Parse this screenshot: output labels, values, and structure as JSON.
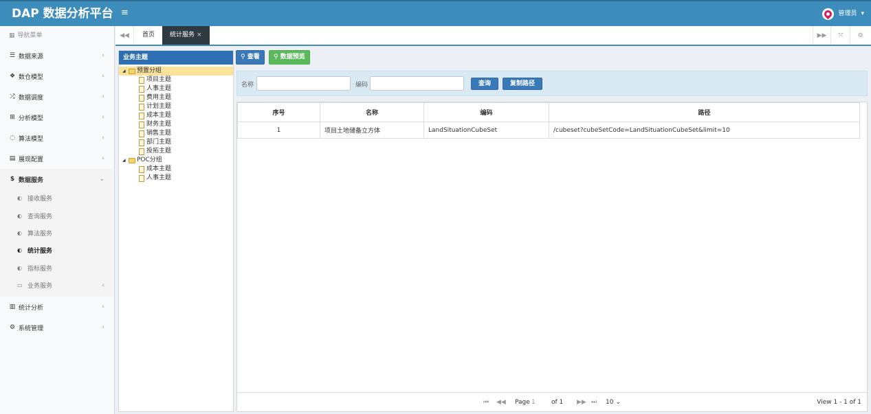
{
  "app": {
    "title": "DAP 数据分析平台",
    "menu_icon": "hamburger-icon"
  },
  "user": {
    "name": "管理员",
    "caret": "▾"
  },
  "sidebar": {
    "header": "导航菜单",
    "items": [
      {
        "label": "数据来源",
        "icon": "database-icon",
        "glyph": "☰",
        "chev": "‹"
      },
      {
        "label": "数仓模型",
        "icon": "cubes-icon",
        "glyph": "❖",
        "chev": "‹"
      },
      {
        "label": "数据调度",
        "icon": "shuffle-icon",
        "glyph": "⤮",
        "chev": "‹"
      },
      {
        "label": "分析模型",
        "icon": "sitemap-icon",
        "glyph": "⊞",
        "chev": "‹"
      },
      {
        "label": "算法模型",
        "icon": "spinner-icon",
        "glyph": "◌",
        "chev": "‹"
      },
      {
        "label": "展现配置",
        "icon": "film-icon",
        "glyph": "▤",
        "chev": "‹"
      },
      {
        "label": "数据服务",
        "icon": "dollar-icon",
        "glyph": "$",
        "chev": "⌄"
      }
    ],
    "sub_items": [
      {
        "label": "接收服务",
        "glyph": "◐",
        "chev": ""
      },
      {
        "label": "查询服务",
        "glyph": "◐",
        "chev": ""
      },
      {
        "label": "算法服务",
        "glyph": "◐",
        "chev": ""
      },
      {
        "label": "统计服务",
        "glyph": "◐",
        "chev": ""
      },
      {
        "label": "指标服务",
        "glyph": "◐",
        "chev": ""
      },
      {
        "label": "业务服务",
        "glyph": "▭",
        "chev": "‹"
      }
    ],
    "bottom_items": [
      {
        "label": "统计分析",
        "icon": "bar-chart-icon",
        "glyph": "▥",
        "chev": "‹"
      },
      {
        "label": "系统管理",
        "icon": "cog-icon",
        "glyph": "⚙",
        "chev": "‹"
      }
    ]
  },
  "tabs": {
    "home": "首页",
    "active": "统计服务",
    "close": "×"
  },
  "tree": {
    "title": "业务主题",
    "groups": [
      {
        "label": "预置分组",
        "children": [
          "项目主题",
          "人事主题",
          "费用主题",
          "计划主题",
          "成本主题",
          "财务主题",
          "销售主题",
          "部门主题",
          "投拓主题"
        ]
      },
      {
        "label": "POC分组",
        "children": [
          "成本主题",
          "人事主题"
        ]
      }
    ]
  },
  "toolbar": {
    "view": "查看",
    "preview": "数据预览"
  },
  "search": {
    "name_label": "名称",
    "name_value": "",
    "code_label": "编码",
    "code_value": "",
    "query_button": "查询",
    "copy_button": "复制路径"
  },
  "grid": {
    "columns": [
      "序号",
      "名称",
      "编码",
      "路径"
    ],
    "rows": [
      {
        "index": "1",
        "name": "项目土地储备立方体",
        "code": "LandSituationCubeSet",
        "path": "/cubeset?cubeSetCode=LandSituationCubeSet&limit=10"
      }
    ]
  },
  "pager": {
    "page_label": "Page",
    "page_value": "1",
    "of_label": "of 1",
    "page_size": "10",
    "summary": "View 1 - 1 of 1"
  }
}
